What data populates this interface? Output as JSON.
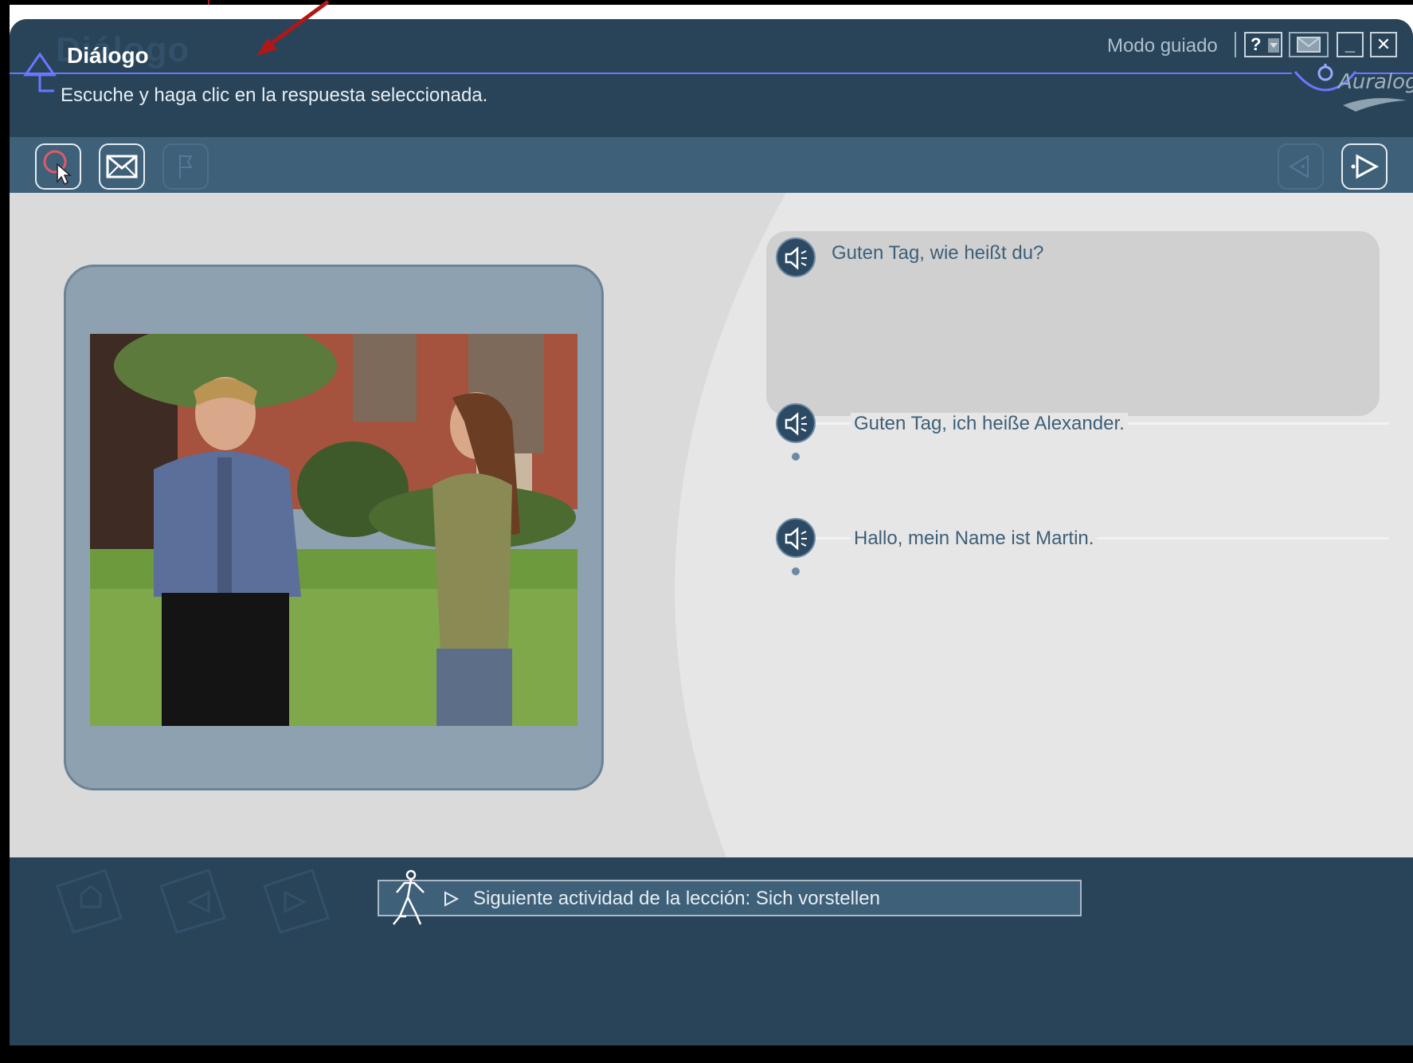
{
  "header": {
    "title": "Diálogo",
    "title_ghost": "Diálogo",
    "subtitle": "Escuche y haga clic en la respuesta seleccionada.",
    "mode_label": "Modo guiado",
    "help_label": "?",
    "minimize_label": "_",
    "close_label": "✕",
    "brand": "Auralog"
  },
  "toolbar": {
    "buttons": [
      "select-pointer-icon",
      "envelope-icon",
      "flag-icon",
      "prev-arrow-icon",
      "next-arrow-icon"
    ]
  },
  "dialog": {
    "question": "Guten Tag, wie heißt du?",
    "answers": [
      "Guten Tag, ich heiße Alexander.",
      "Hallo, mein Name ist Martin."
    ]
  },
  "footer": {
    "next_activity": "Siguiente actividad de la lección: Sich vorstellen"
  },
  "colors": {
    "window_bg": "#294459",
    "toolbar_bg": "#3f6079",
    "content_bg": "#e6e6e6",
    "accent_line": "#6c76ff",
    "text_blue": "#3e5f78",
    "annotation_red": "#b01818"
  }
}
